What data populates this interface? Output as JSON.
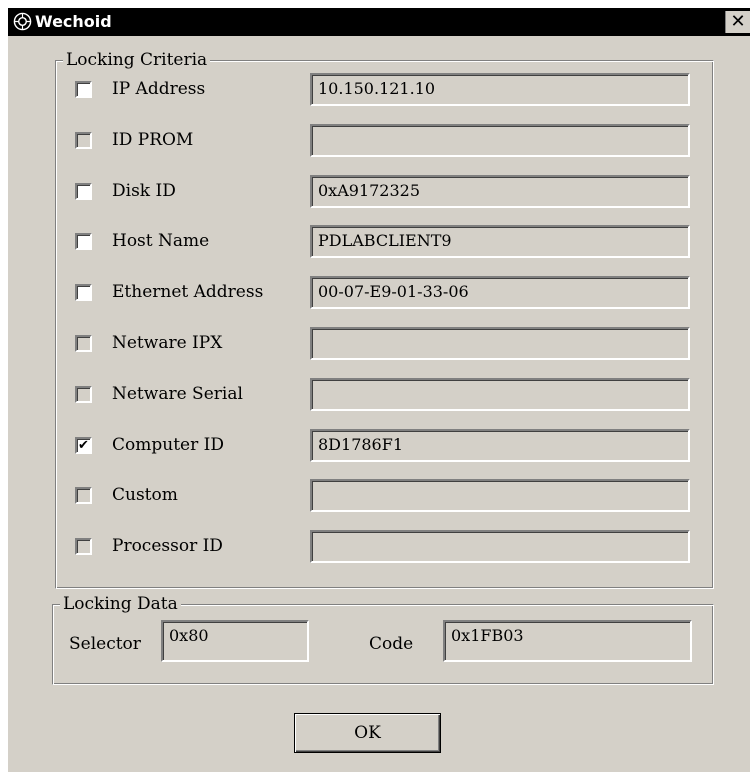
{
  "window": {
    "title": "Wechoid",
    "close_glyph": "✕"
  },
  "locking_criteria": {
    "legend": "Locking Criteria",
    "rows": [
      {
        "label": "IP Address",
        "value": "10.150.121.10",
        "checked": false,
        "enabled": true
      },
      {
        "label": "ID PROM",
        "value": "",
        "checked": false,
        "enabled": false
      },
      {
        "label": "Disk ID",
        "value": "0xA9172325",
        "checked": false,
        "enabled": true
      },
      {
        "label": "Host Name",
        "value": "PDLABCLIENT9",
        "checked": false,
        "enabled": true
      },
      {
        "label": "Ethernet Address",
        "value": "00-07-E9-01-33-06",
        "checked": false,
        "enabled": true
      },
      {
        "label": "Netware IPX",
        "value": "",
        "checked": false,
        "enabled": false
      },
      {
        "label": "Netware Serial",
        "value": "",
        "checked": false,
        "enabled": false
      },
      {
        "label": "Computer ID",
        "value": "8D1786F1",
        "checked": true,
        "enabled": true
      },
      {
        "label": "Custom",
        "value": "",
        "checked": false,
        "enabled": false
      },
      {
        "label": "Processor ID",
        "value": "",
        "checked": false,
        "enabled": false
      }
    ]
  },
  "locking_data": {
    "legend": "Locking Data",
    "selector_label": "Selector",
    "selector_value": "0x80",
    "code_label": "Code",
    "code_value": "0x1FB03"
  },
  "ok_label": "OK",
  "check_glyph": "✔"
}
